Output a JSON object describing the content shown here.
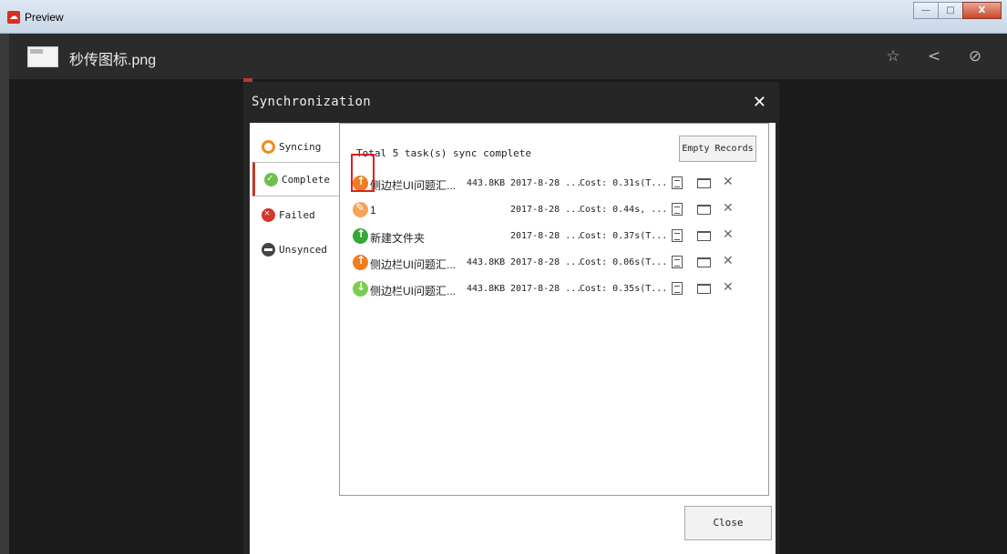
{
  "window": {
    "title": "Preview",
    "controls": [
      "—",
      "□",
      "X"
    ]
  },
  "viewer": {
    "file_name": "秒传图标.png",
    "icons": [
      "star-icon",
      "share-icon",
      "link-icon"
    ]
  },
  "dialog": {
    "title": "Synchronization",
    "close_glyph": "✕",
    "tabs": [
      {
        "label": "Syncing",
        "icon": "sync-icon"
      },
      {
        "label": "Complete",
        "icon": "check-circle-icon"
      },
      {
        "label": "Failed",
        "icon": "x-circle-icon"
      },
      {
        "label": "Unsynced",
        "icon": "minus-circle-icon"
      }
    ],
    "summary": "Total 5 task(s) sync complete",
    "empty_records": "Empty Records",
    "close_button": "Close",
    "rows": [
      {
        "icon": "upload-orange-icon",
        "name": "侧边栏UI问题汇...",
        "size": "443.8KB",
        "date": "2017-8-28 ...",
        "cost": "Cost: 0.31s(T..."
      },
      {
        "icon": "edit-orange-icon",
        "name": "1",
        "size": "",
        "date": "2017-8-28 ...",
        "cost": "Cost: 0.44s, ..."
      },
      {
        "icon": "upload-green-icon",
        "name": "新建文件夹",
        "size": "",
        "date": "2017-8-28 ...",
        "cost": "Cost: 0.37s(T..."
      },
      {
        "icon": "upload-orange-icon",
        "name": "侧边栏UI问题汇...",
        "size": "443.8KB",
        "date": "2017-8-28 ...",
        "cost": "Cost: 0.06s(T..."
      },
      {
        "icon": "download-green-icon",
        "name": "侧边栏UI问题汇...",
        "size": "443.8KB",
        "date": "2017-8-28 ...",
        "cost": "Cost: 0.35s(T..."
      }
    ]
  }
}
